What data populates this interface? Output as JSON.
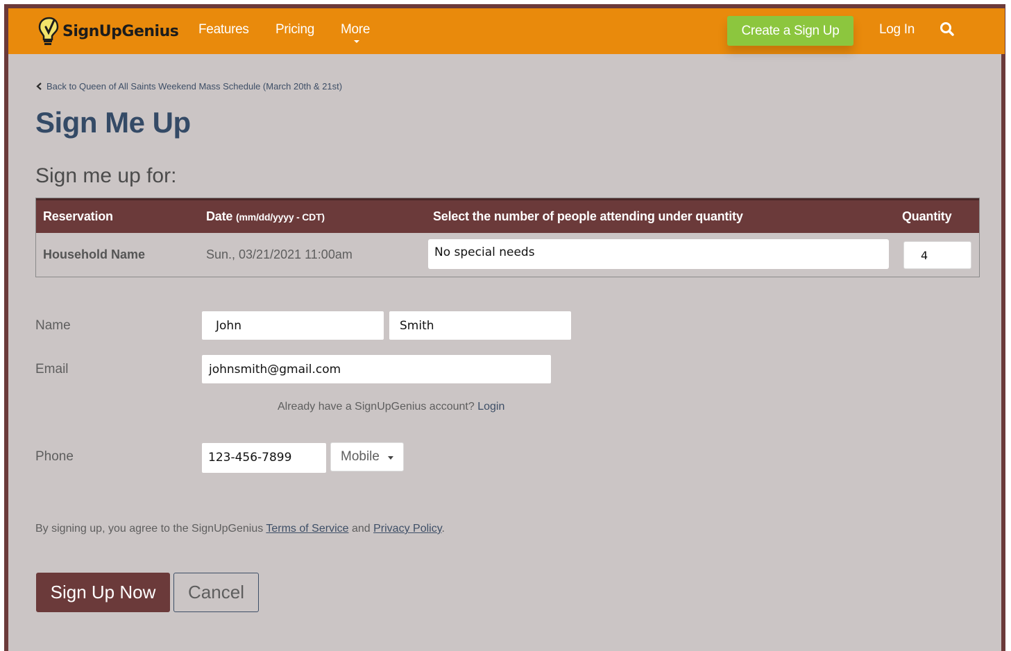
{
  "navbar": {
    "logo_text": "SignUpGenius",
    "links": [
      "Features",
      "Pricing",
      "More"
    ],
    "create_label": "Create a Sign Up",
    "login_label": "Log In",
    "search_icon": "search-icon",
    "colors": {
      "bar": "#e98a0c",
      "create": "#8cc63e"
    }
  },
  "back_link": "Back to Queen of All Saints Weekend Mass Schedule (March 20th & 21st)",
  "page_title": "Sign Me Up",
  "section_heading": "Sign me up for:",
  "table": {
    "headers": {
      "reservation": "Reservation",
      "date": "Date",
      "date_note": "(mm/dd/yyyy - CDT)",
      "select": "Select the number of people attending under quantity",
      "quantity": "Quantity"
    },
    "row": {
      "reservation": "Household Name",
      "date": "Sun., 03/21/2021 11:00am",
      "needs": "No special needs",
      "quantity": "4"
    },
    "header_color": "#6b3a3a"
  },
  "form": {
    "name_label": "Name",
    "first_name": "John",
    "last_name": "Smith",
    "email_label": "Email",
    "email": "johnsmith@gmail.com",
    "account_prompt": "Already have a SignUpGenius account?",
    "login_link": "Login",
    "phone_label": "Phone",
    "phone": "123-456-7899",
    "phone_type": "Mobile"
  },
  "terms": {
    "prefix": "By signing up, you agree to the SignUpGenius",
    "tos": "Terms of Service",
    "and": "and",
    "privacy": "Privacy Policy",
    "suffix": "."
  },
  "buttons": {
    "signup": "Sign Up Now",
    "cancel": "Cancel",
    "signup_color": "#6b3a3a"
  }
}
